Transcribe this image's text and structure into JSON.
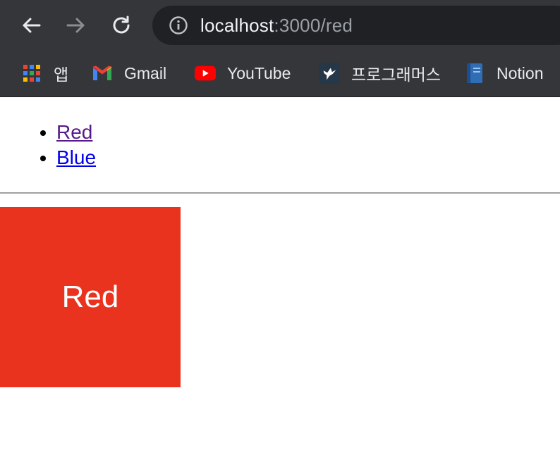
{
  "browser": {
    "url_host": "localhost",
    "url_path": ":3000/red",
    "bookmarks": [
      {
        "label": "앱",
        "icon": "apps-grid-icon"
      },
      {
        "label": "Gmail",
        "icon": "gmail-icon"
      },
      {
        "label": "YouTube",
        "icon": "youtube-icon"
      },
      {
        "label": "프로그래머스",
        "icon": "programmers-icon"
      },
      {
        "label": "Notion",
        "icon": "notion-icon"
      }
    ]
  },
  "page": {
    "nav_links": [
      {
        "label": "Red",
        "visited": true
      },
      {
        "label": "Blue",
        "visited": false
      }
    ],
    "box_label": "Red",
    "colors": {
      "box": "#e9331f",
      "visited_link": "#551a8b",
      "link": "#0000ee"
    }
  }
}
